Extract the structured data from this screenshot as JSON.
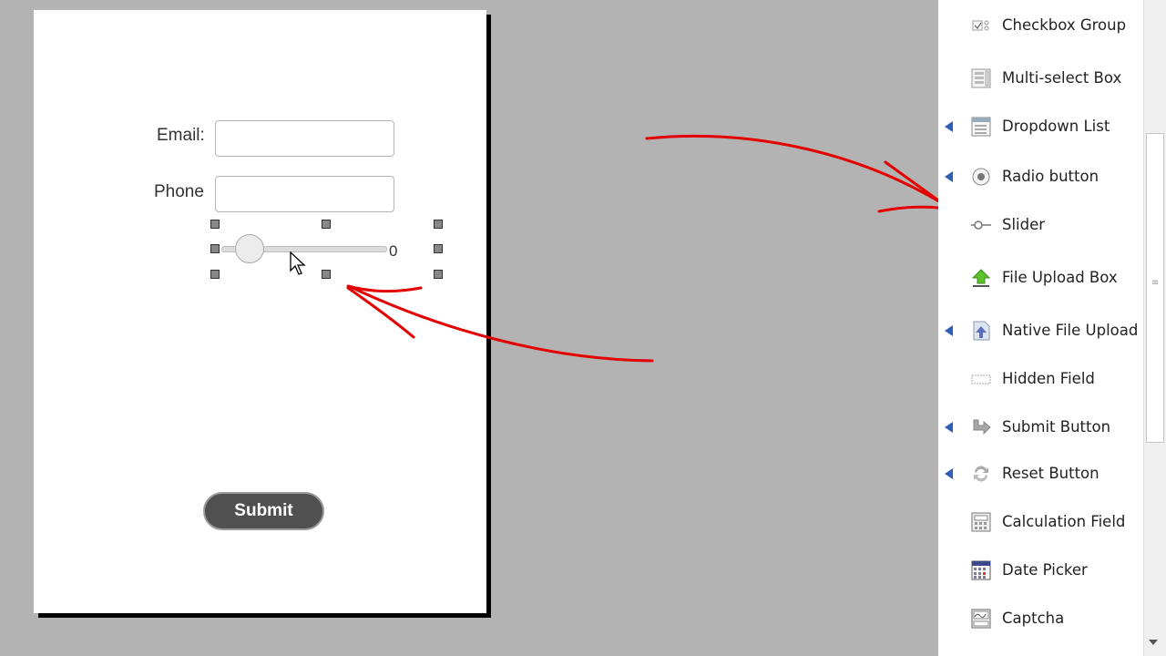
{
  "form": {
    "email_label": "Email:",
    "phone_label": "Phone",
    "email_value": "",
    "phone_value": "",
    "slider_value": "0",
    "submit_label": "Submit"
  },
  "palette": {
    "items": [
      {
        "label": "Checkbox Group",
        "icon": "checkbox-group-icon",
        "has_arrow": false
      },
      {
        "label": "Multi-select Box",
        "icon": "multi-select-icon",
        "has_arrow": false
      },
      {
        "label": "Dropdown List",
        "icon": "dropdown-list-icon",
        "has_arrow": true
      },
      {
        "label": "Radio button",
        "icon": "radio-button-icon",
        "has_arrow": true
      },
      {
        "label": "Slider",
        "icon": "slider-icon",
        "has_arrow": false
      },
      {
        "label": "File Upload Box",
        "icon": "file-upload-icon",
        "has_arrow": false
      },
      {
        "label": "Native File Upload",
        "icon": "native-file-upload-icon",
        "has_arrow": true
      },
      {
        "label": "Hidden Field",
        "icon": "hidden-field-icon",
        "has_arrow": false
      },
      {
        "label": "Submit Button",
        "icon": "submit-button-icon",
        "has_arrow": true
      },
      {
        "label": "Reset Button",
        "icon": "reset-button-icon",
        "has_arrow": true
      },
      {
        "label": "Calculation Field",
        "icon": "calculation-field-icon",
        "has_arrow": false
      },
      {
        "label": "Date Picker",
        "icon": "date-picker-icon",
        "has_arrow": false
      },
      {
        "label": "Captcha",
        "icon": "captcha-icon",
        "has_arrow": false
      }
    ]
  },
  "colors": {
    "canvas_bg": "#b3b3b3",
    "arrow_red": "#e30000",
    "palette_arrow_blue": "#2f5fb4",
    "submit_bg": "#505050"
  }
}
